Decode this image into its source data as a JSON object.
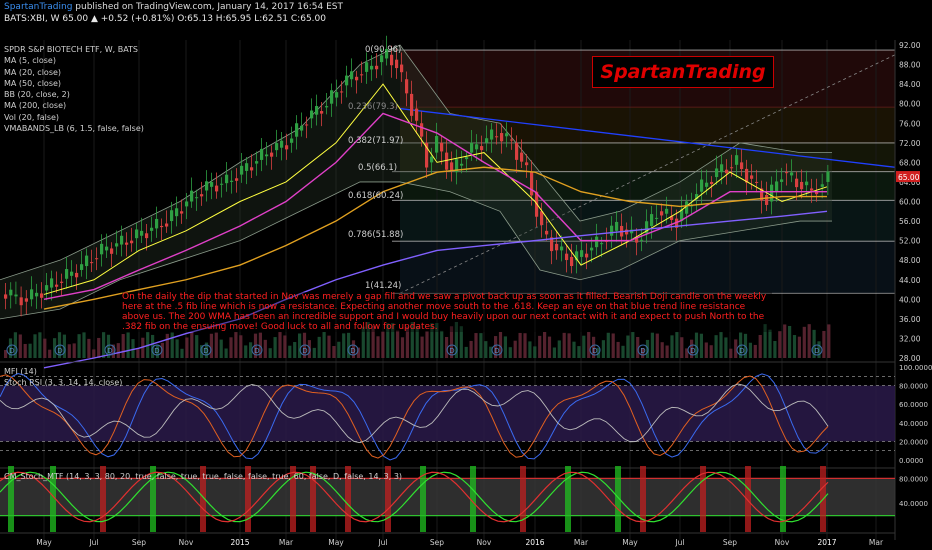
{
  "header": {
    "author": "SpartanTrading",
    "published": "published on TradingView.com, January 14, 2017 16:54 EST",
    "quote": "BATS:XBI, W  65.00 ▲ +0.52 (+0.81%) O:65.13 H:65.95 L:62.51 C:65.00"
  },
  "legend": {
    "title": "SPDR S&P BIOTECH ETF, W, BATS",
    "items": [
      "MA (5, close)",
      "MA (20, close)",
      "MA (50, close)",
      "BB (20, close, 2)",
      "MA (200, close)",
      "Vol (20, false)",
      "VMABANDS_LB (6, 1.5, false, false)"
    ]
  },
  "watermark": "SpartanTrading",
  "comment": "On the daily the dip that started in Nov was merely a gap fill and we saw a pivot back up as soon as it filled. Bearish Doji candle on the weekly here at the .5 fib line which is now a resistance. Expecting another move south to the .618. Keep an eye on that blue trend line resistance above us. The 200 WMA has been an incredible support and I would buy heavily upon our next contact with it and expect to push North to the .382 fib on the ensuing move! Good luck to all and follow for updates.",
  "fib_levels": [
    {
      "label": "0(90.96)",
      "value": 90.96
    },
    {
      "label": "0.236(79.3)",
      "value": 79.3
    },
    {
      "label": "0.382(71.97)",
      "value": 71.97
    },
    {
      "label": "0.5(66.1)",
      "value": 66.1
    },
    {
      "label": "0.618(60.24)",
      "value": 60.24
    },
    {
      "label": "0.786(51.88)",
      "value": 51.88
    },
    {
      "label": "1(41.24)",
      "value": 41.24
    }
  ],
  "price_axis": [
    "92.00",
    "88.00",
    "84.00",
    "80.00",
    "76.00",
    "72.00",
    "68.00",
    "64.00",
    "60.00",
    "56.00",
    "52.00",
    "48.00",
    "44.00",
    "40.00",
    "36.00",
    "32.00",
    "28.00"
  ],
  "last_price": "65.00",
  "panes": {
    "mfi_label": "MFI (14)",
    "stoch_label": "Stoch RSI (3, 3, 14, 14, close)",
    "mfi_axis": [
      "100.0000",
      "80.0000",
      "60.0000",
      "40.0000",
      "20.0000",
      "0.0000"
    ],
    "mtf_label": "CM_Stoch_MTF (14, 3, 3, 80, 20, true, false, true, true, false, false, true, 60, false, D, false, 14, 3, 3)",
    "mtf_axis": [
      "80.0000",
      "40.0000"
    ]
  },
  "time_axis": [
    "May",
    "Jul",
    "Sep",
    "Nov",
    "2015",
    "Mar",
    "May",
    "Jul",
    "Sep",
    "Nov",
    "2016",
    "Mar",
    "May",
    "Jul",
    "Sep",
    "Nov",
    "2017",
    "Mar"
  ],
  "dividend_marker": "D",
  "colors": {
    "up": "#2ea043",
    "down": "#d94040",
    "ma5": "#ffff40",
    "ma20": "#e040c8",
    "ma50": "#e0a020",
    "ma200": "#8060ff",
    "bb": "#8a9a8a",
    "trend": "#2040ff",
    "fib": "#ffffff"
  },
  "chart_data": {
    "type": "line",
    "title": "SPDR S&P BIOTECH ETF, W, BATS",
    "x": [
      "May",
      "Jul",
      "Sep",
      "Nov",
      "2015",
      "Mar",
      "May",
      "Jul",
      "Sep",
      "Nov",
      "2016",
      "Mar",
      "May",
      "Jul",
      "Sep",
      "Nov",
      "2017"
    ],
    "series": [
      {
        "name": "MA (5, close)",
        "values": [
          41,
          44,
          50,
          54,
          60,
          64,
          72,
          84,
          68,
          70,
          60,
          47,
          52,
          58,
          66,
          60,
          63
        ]
      },
      {
        "name": "MA (20, close)",
        "values": [
          40,
          42,
          46,
          50,
          55,
          60,
          68,
          78,
          74,
          68,
          62,
          52,
          52,
          56,
          62,
          62,
          62
        ]
      },
      {
        "name": "MA (50, close)",
        "values": [
          38,
          40,
          42,
          44,
          47,
          51,
          56,
          62,
          66,
          67,
          66,
          62,
          60,
          59,
          60,
          61,
          61
        ]
      },
      {
        "name": "MA (200, close)",
        "values": [
          26,
          28,
          30,
          33,
          36,
          40,
          44,
          47,
          50,
          51,
          52,
          53,
          54,
          55,
          56,
          57,
          58
        ]
      }
    ],
    "ylim": [
      26,
      94
    ]
  }
}
